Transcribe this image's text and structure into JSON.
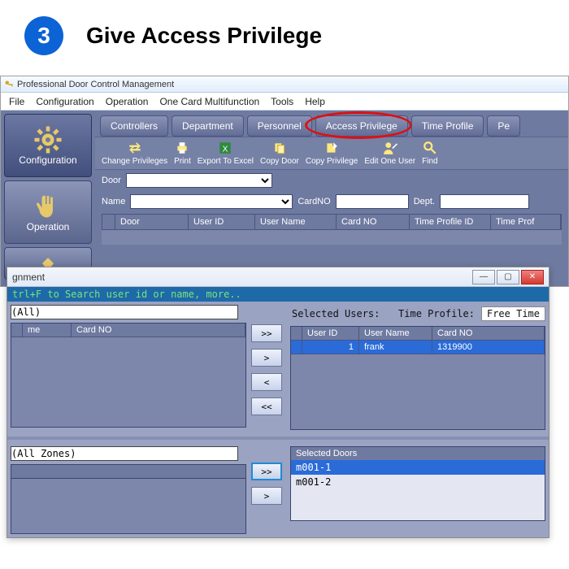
{
  "step": {
    "number": "3",
    "title": "Give Access Privilege"
  },
  "app": {
    "title": "Professional Door Control Management",
    "menu": [
      "File",
      "Configuration",
      "Operation",
      "One Card Multifunction",
      "Tools",
      "Help"
    ],
    "sidebar": [
      {
        "label": "Configuration",
        "active": true
      },
      {
        "label": "Operation",
        "active": false
      }
    ],
    "tabs": [
      "Controllers",
      "Department",
      "Personnel",
      "Access Privilege",
      "Time Profile",
      "Pe"
    ],
    "tabs_highlight_index": 3,
    "toolbar": [
      "Change Privileges",
      "Print",
      "Export To Excel",
      "Copy Door",
      "Copy Privilege",
      "Edit One User",
      "Find"
    ],
    "filters": {
      "door_label": "Door",
      "name_label": "Name",
      "cardno_label": "CardNO",
      "dept_label": "Dept."
    },
    "grid_headers": [
      "Door",
      "User ID",
      "User Name",
      "Card NO",
      "Time Profile ID",
      "Time Prof"
    ]
  },
  "dialog": {
    "title_fragment": "gnment",
    "hint": "trl+F  to Search user id or name,  more..",
    "left_combo": "(All)",
    "left_grid_headers": [
      "me",
      "Card NO"
    ],
    "selected_users_label": "Selected Users:",
    "time_profile_label": "Time Profile:",
    "time_profile_value": "Free Time",
    "right_grid_headers": [
      "User ID",
      "User Name",
      "Card NO"
    ],
    "right_grid_rows": [
      {
        "id": "1",
        "name": "frank",
        "card": "1319900",
        "selected": true
      }
    ],
    "zones_combo": "(All Zones)",
    "selected_doors_label": "Selected Doors",
    "selected_doors": [
      {
        "name": "m001-1",
        "selected": true
      },
      {
        "name": "m001-2",
        "selected": false
      }
    ],
    "arrows": {
      "add_all": ">>",
      "add": ">",
      "remove": "<",
      "remove_all": "<<"
    }
  }
}
